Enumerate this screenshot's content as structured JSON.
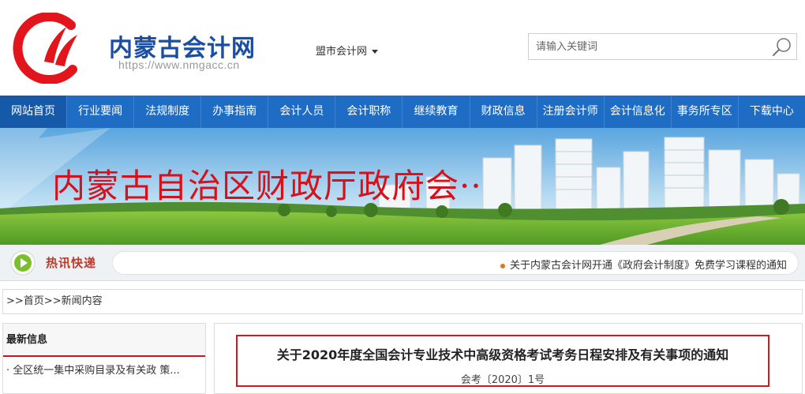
{
  "header": {
    "site_name": "内蒙古会计网",
    "site_url": "https://www.nmgacc.cn",
    "region_select": "盟市会计网",
    "search_placeholder": "请输入关键词"
  },
  "nav": {
    "items": [
      "网站首页",
      "行业要闻",
      "法规制度",
      "办事指南",
      "会计人员",
      "会计职称",
      "继续教育",
      "财政信息",
      "注册会计师",
      "会计信息化",
      "事务所专区",
      "下载中心"
    ],
    "active_index": 0
  },
  "banner": {
    "title": "内蒙古自治区财政厅政府会··"
  },
  "ticker": {
    "label": "热讯快递",
    "text": "关于内蒙古会计网开通《政府会计制度》免费学习课程的通知"
  },
  "breadcrumb": {
    "home": ">>首页",
    "current": ">>新闻内容"
  },
  "sidebar": {
    "heading": "最新信息",
    "items": [
      "· 全区统一集中采购目录及有关政 策..."
    ]
  },
  "article": {
    "title": "关于2020年度全国会计专业技术中高级资格考试考务日程安排及有关事项的通知",
    "doc_no": "会考〔2020〕1号"
  },
  "colors": {
    "nav_bg": "#1f6cc4",
    "brand_blue": "#1a4ea3",
    "accent_red": "#d5121b"
  }
}
